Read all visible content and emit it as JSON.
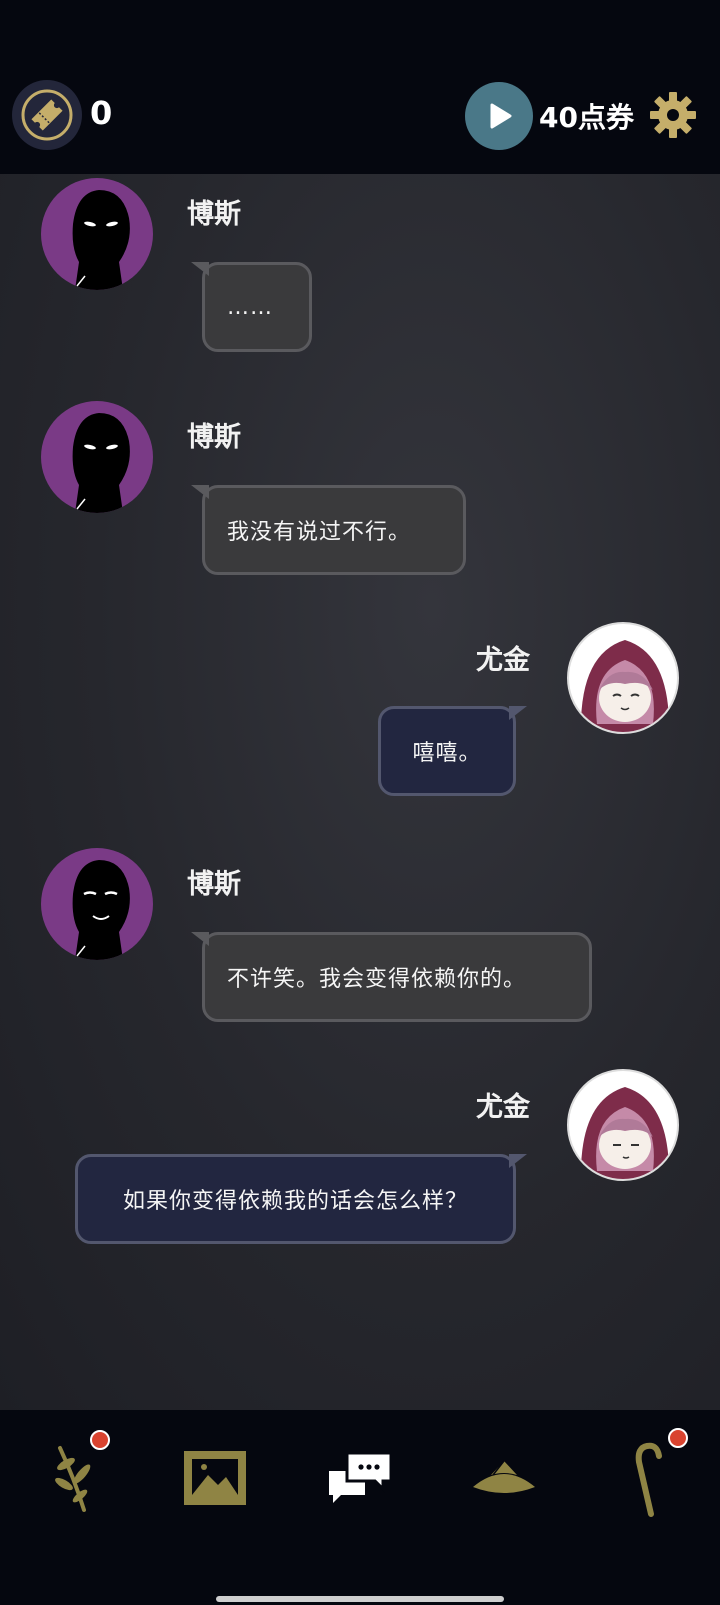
{
  "header": {
    "ticket_count": "0",
    "coupon_text": "40点券"
  },
  "messages": [
    {
      "sender": "博斯",
      "text": "……",
      "side": "left",
      "avatar": "boss-silhouette"
    },
    {
      "sender": "博斯",
      "text": "我没有说过不行。",
      "side": "left",
      "avatar": "boss-silhouette"
    },
    {
      "sender": "尤金",
      "text": "嘻嘻。",
      "side": "right",
      "avatar": "yujin-hooded"
    },
    {
      "sender": "博斯",
      "text": "不许笑。我会变得依赖你的。",
      "side": "left",
      "avatar": "boss-silhouette-smile"
    },
    {
      "sender": "尤金",
      "text": "如果你变得依赖我的话会怎么样？",
      "side": "right",
      "avatar": "yujin-hooded"
    }
  ],
  "bottom_nav": [
    {
      "icon": "herb-icon",
      "badge": true
    },
    {
      "icon": "gallery-icon",
      "badge": false
    },
    {
      "icon": "chat-icon",
      "badge": false
    },
    {
      "icon": "hat-icon",
      "badge": false
    },
    {
      "icon": "cane-icon",
      "badge": true
    }
  ],
  "colors": {
    "bar_bg": "#05070f",
    "left_bubble": "#3a3a3c",
    "right_bubble": "#222640",
    "boss_avatar_bg": "#7a3a86",
    "gold": "#c5ae6a",
    "badge": "#d9432f"
  }
}
